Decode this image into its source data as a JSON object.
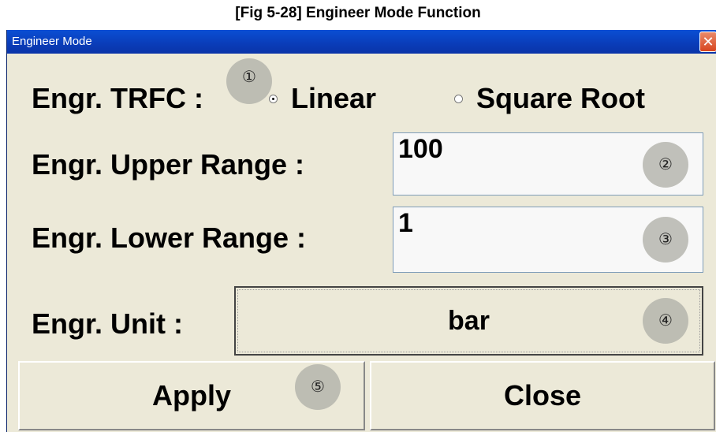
{
  "caption": "[Fig 5-28] Engineer Mode Function",
  "window": {
    "title": "Engineer Mode",
    "close_glyph": "✕"
  },
  "form": {
    "trfc_label": "Engr. TRFC :",
    "trfc_options": [
      {
        "label": "Linear",
        "selected": true
      },
      {
        "label": "Square Root",
        "selected": false
      }
    ],
    "upper_label": "Engr. Upper Range :",
    "upper_value": "100",
    "lower_label": "Engr. Lower Range :",
    "lower_value": "1",
    "unit_label": "Engr. Unit :",
    "unit_value": "bar"
  },
  "buttons": {
    "apply": "Apply",
    "close": "Close"
  },
  "markers": [
    "①",
    "②",
    "③",
    "④",
    "⑤"
  ],
  "colors": {
    "window_bg": "#ece9d8",
    "titlebar": "#0a46c8",
    "marker": "#b2b2aa"
  }
}
